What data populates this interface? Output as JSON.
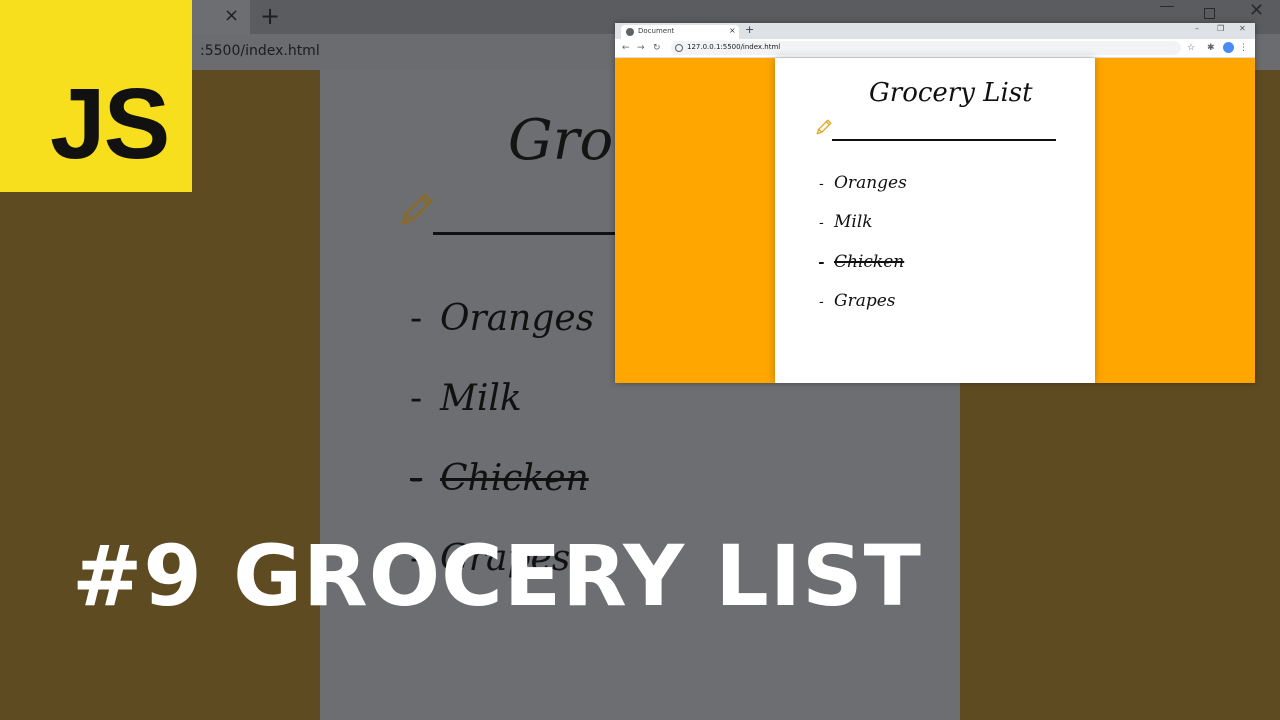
{
  "background_browser": {
    "url_fragment": ":5500/index.html",
    "tab_close_icon": "×",
    "new_tab_icon": "+",
    "page_title": "Groce",
    "items": [
      {
        "dash": "-",
        "text": "Oranges"
      },
      {
        "dash": "-",
        "text": "Milk"
      },
      {
        "dash": "-",
        "text": "Chicken"
      },
      {
        "dash": "-",
        "text": "Grapes"
      }
    ]
  },
  "logo": {
    "text": "JS",
    "color": "#f7df1e"
  },
  "inset_browser": {
    "tab_title": "Document",
    "tab_close_icon": "×",
    "new_tab_icon": "+",
    "url": "127.0.0.1:5500/index.html",
    "page": {
      "title": "Grocery List",
      "items": [
        {
          "dash": "-",
          "text": "Oranges",
          "crossed_out": false
        },
        {
          "dash": "-",
          "text": "Milk",
          "crossed_out": false
        },
        {
          "dash": "-",
          "text": "Chicken",
          "crossed_out": true
        },
        {
          "dash": "-",
          "text": "Grapes",
          "crossed_out": false
        }
      ]
    },
    "accent_color": "#ffa600"
  },
  "caption": "#9 GROCERY LIST"
}
